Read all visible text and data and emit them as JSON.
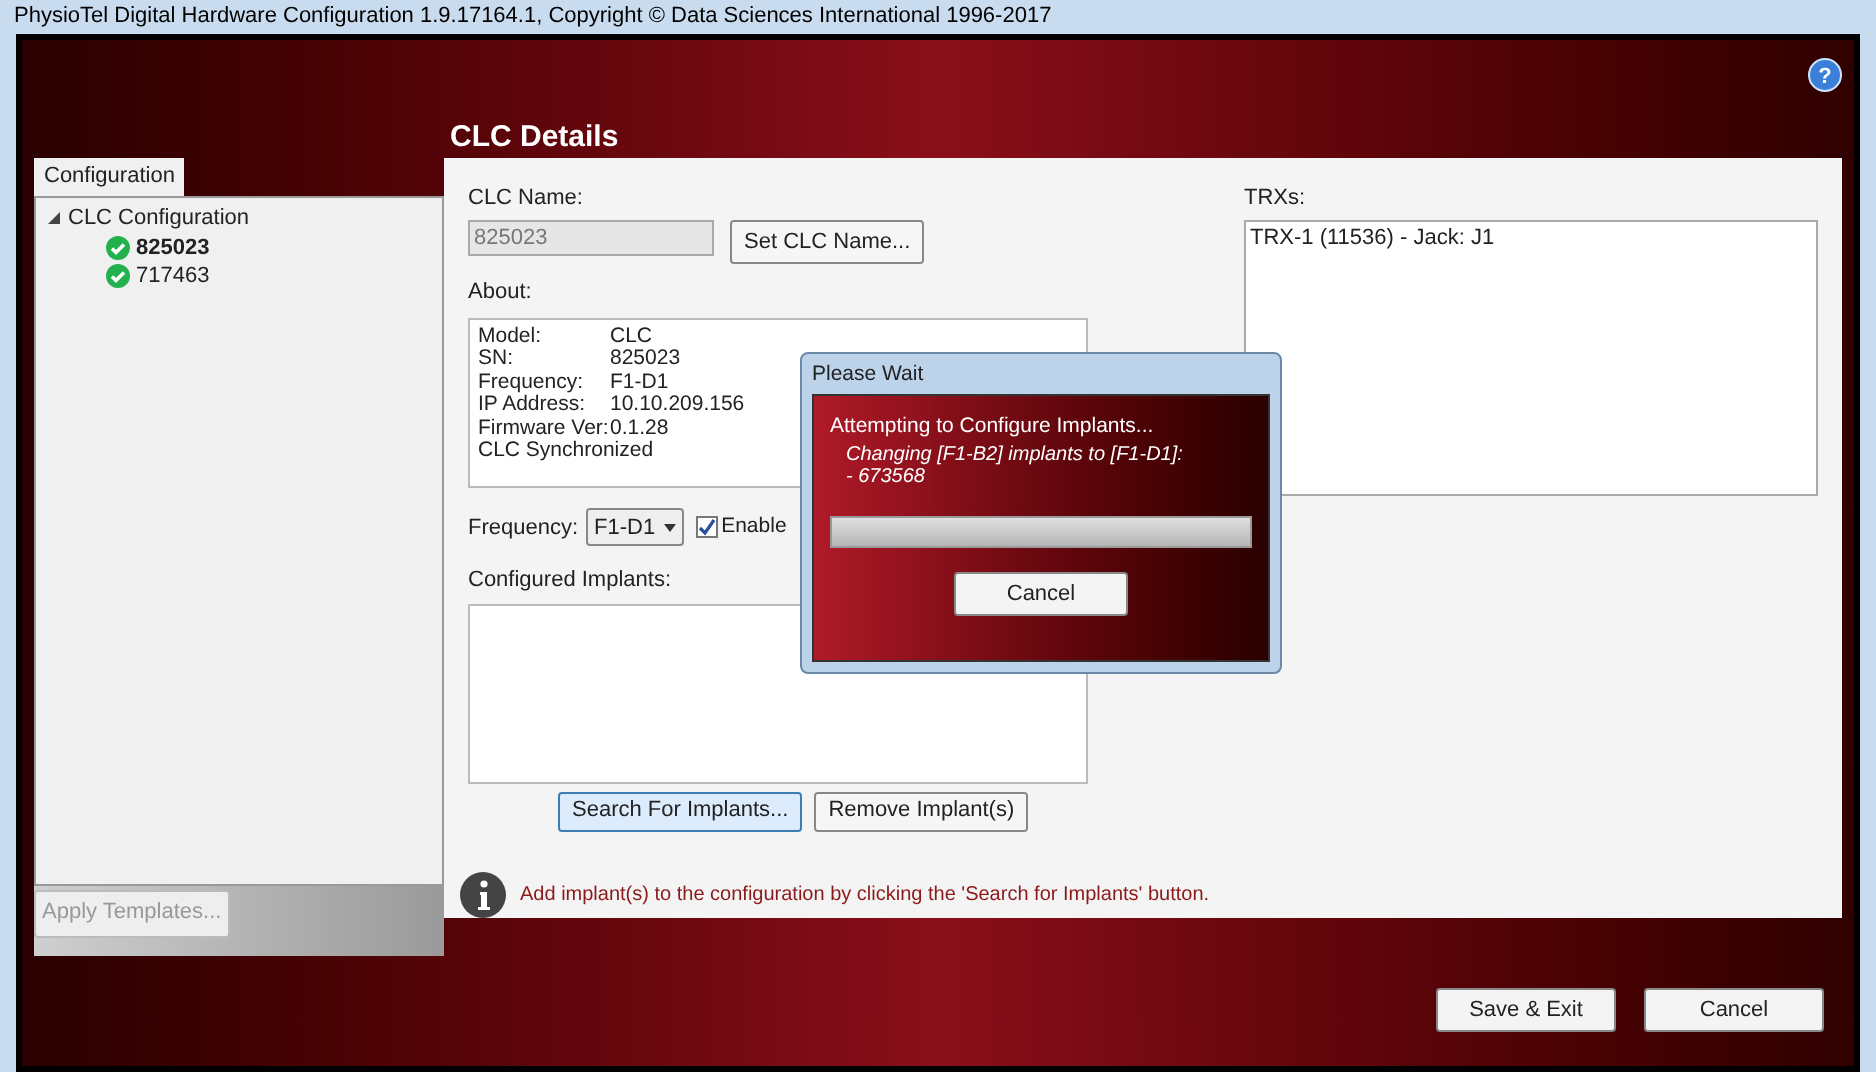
{
  "window": {
    "title": "PhysioTel Digital Hardware Configuration 1.9.17164.1, Copyright © Data Sciences International 1996-2017"
  },
  "tabs": [
    {
      "label": "Configuration",
      "selected": true
    }
  ],
  "tree": {
    "label": "CLC Configuration",
    "expanded": true,
    "children": [
      {
        "label": "825023",
        "selected": true,
        "synced": true
      },
      {
        "label": "717463",
        "selected": false,
        "synced": true
      }
    ]
  },
  "help": "?",
  "apply_templates": {
    "label": "Apply Templates...",
    "disabled": true
  },
  "heading": "CLC Details",
  "clc_name": {
    "label": "CLC Name:",
    "value": "825023",
    "button": "Set CLC Name..."
  },
  "about": {
    "label": "About:",
    "rows": [
      {
        "key": "Model:",
        "value": "CLC"
      },
      {
        "key": "SN:",
        "value": "825023"
      },
      {
        "key": "Frequency:",
        "value": "F1-D1"
      },
      {
        "key": "IP Address:",
        "value": "10.10.209.156"
      },
      {
        "key": "Firmware Ver:",
        "value": "0.1.28"
      },
      {
        "key": "CLC Synchronized"
      }
    ]
  },
  "frequency": {
    "label": "Frequency:",
    "value": "F1-D1",
    "checkbox_label": "Enable",
    "checked": true
  },
  "configured_implants": {
    "label": "Configured Implants:",
    "buttons": [
      {
        "label": "Search For Implants...",
        "focused": true
      },
      {
        "label": "Remove Implant(s)",
        "focused": false
      }
    ]
  },
  "info": "Add implant(s) to the configuration by clicking the 'Search for Implants' button.",
  "trxs": {
    "label": "TRXs:",
    "items": [
      "TRX-1 (11536) - Jack: J1"
    ]
  },
  "footer_buttons": [
    "Save & Exit",
    "Cancel"
  ],
  "dialog": {
    "title": "Please Wait",
    "message": "Attempting to Configure Implants...",
    "detail": [
      "Changing [F1-B2] implants to [F1-D1]:",
      "- 673568"
    ],
    "level": 1,
    "button": "Cancel"
  }
}
